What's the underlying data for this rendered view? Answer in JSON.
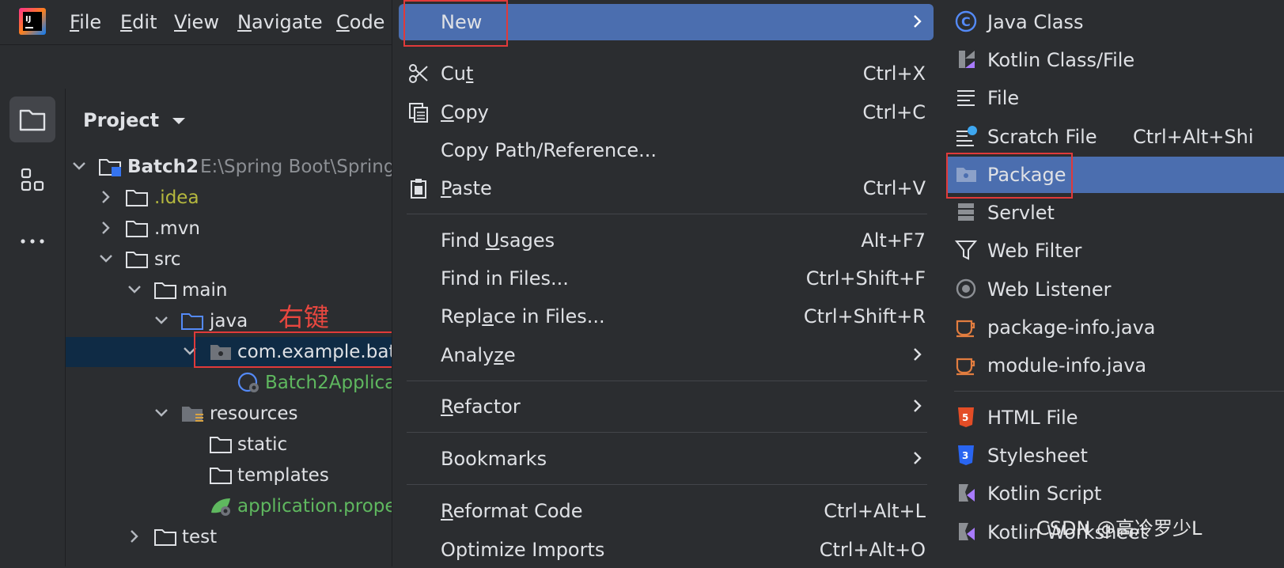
{
  "menubar": {
    "items": [
      {
        "pre": "",
        "ul": "F",
        "post": "ile"
      },
      {
        "pre": "",
        "ul": "E",
        "post": "dit"
      },
      {
        "pre": "",
        "ul": "V",
        "post": "iew"
      },
      {
        "pre": "",
        "ul": "N",
        "post": "avigate"
      },
      {
        "pre": "",
        "ul": "C",
        "post": "ode"
      }
    ]
  },
  "logo_text": "IJ",
  "project_panel": {
    "title": "Project",
    "tree": [
      {
        "label": "Batch2",
        "path": "E:\\Spring Boot\\Spring"
      },
      {
        "label": ".idea"
      },
      {
        "label": ".mvn"
      },
      {
        "label": "src"
      },
      {
        "label": "main"
      },
      {
        "label": "java"
      },
      {
        "label": "com.example.batc"
      },
      {
        "label": "Batch2Applica"
      },
      {
        "label": "resources"
      },
      {
        "label": "static"
      },
      {
        "label": "templates"
      },
      {
        "label": "application.prope"
      },
      {
        "label": "test"
      }
    ]
  },
  "annotation": {
    "right_click": "右键"
  },
  "context_menu": {
    "items": [
      {
        "label": "New",
        "shortcut": "",
        "submenu": true,
        "highlighted": true
      },
      {
        "pre": "Cu",
        "ul": "t",
        "post": "",
        "shortcut": "Ctrl+X"
      },
      {
        "pre": "",
        "ul": "C",
        "post": "opy",
        "shortcut": "Ctrl+C"
      },
      {
        "label": "Copy Path/Reference...",
        "shortcut": ""
      },
      {
        "pre": "",
        "ul": "P",
        "post": "aste",
        "shortcut": "Ctrl+V"
      },
      {
        "pre": "Find ",
        "ul": "U",
        "post": "sages",
        "shortcut": "Alt+F7"
      },
      {
        "label": "Find in Files...",
        "shortcut": "Ctrl+Shift+F"
      },
      {
        "pre": "Repl",
        "ul": "a",
        "post": "ce in Files...",
        "shortcut": "Ctrl+Shift+R"
      },
      {
        "pre": "Analy",
        "ul": "z",
        "post": "e",
        "submenu": true
      },
      {
        "pre": "",
        "ul": "R",
        "post": "efactor",
        "submenu": true
      },
      {
        "label": "Bookmarks",
        "submenu": true
      },
      {
        "pre": "",
        "ul": "R",
        "post": "eformat Code",
        "shortcut": "Ctrl+Alt+L"
      },
      {
        "label": "Optimize Imports",
        "shortcut": "Ctrl+Alt+O"
      }
    ]
  },
  "new_submenu": {
    "items": [
      {
        "label": "Java Class",
        "icon": "java-class-icon"
      },
      {
        "label": "Kotlin Class/File",
        "icon": "kotlin-icon"
      },
      {
        "label": "File",
        "icon": "file-lines-icon"
      },
      {
        "label": "Scratch File",
        "shortcut": "Ctrl+Alt+Shi",
        "icon": "scratch-file-icon"
      },
      {
        "label": "Package",
        "icon": "package-icon",
        "highlighted": true
      },
      {
        "label": "Servlet",
        "icon": "servlet-icon"
      },
      {
        "label": "Web Filter",
        "icon": "filter-icon"
      },
      {
        "label": "Web Listener",
        "icon": "listener-icon"
      },
      {
        "label": "package-info.java",
        "icon": "java-cup-icon"
      },
      {
        "label": "module-info.java",
        "icon": "java-cup-icon"
      },
      {
        "label": "HTML File",
        "icon": "html5-icon"
      },
      {
        "label": "Stylesheet",
        "icon": "css3-icon"
      },
      {
        "label": "Kotlin Script",
        "icon": "kotlin-script-icon"
      },
      {
        "label": "Kotlin Worksheet",
        "icon": "kotlin-worksheet-icon"
      }
    ]
  },
  "watermark": "CSDN @高冷罗少L",
  "colors": {
    "accent": "#4b6eaf",
    "annotation_red": "#e03a3a",
    "selection": "#0f2b45"
  }
}
